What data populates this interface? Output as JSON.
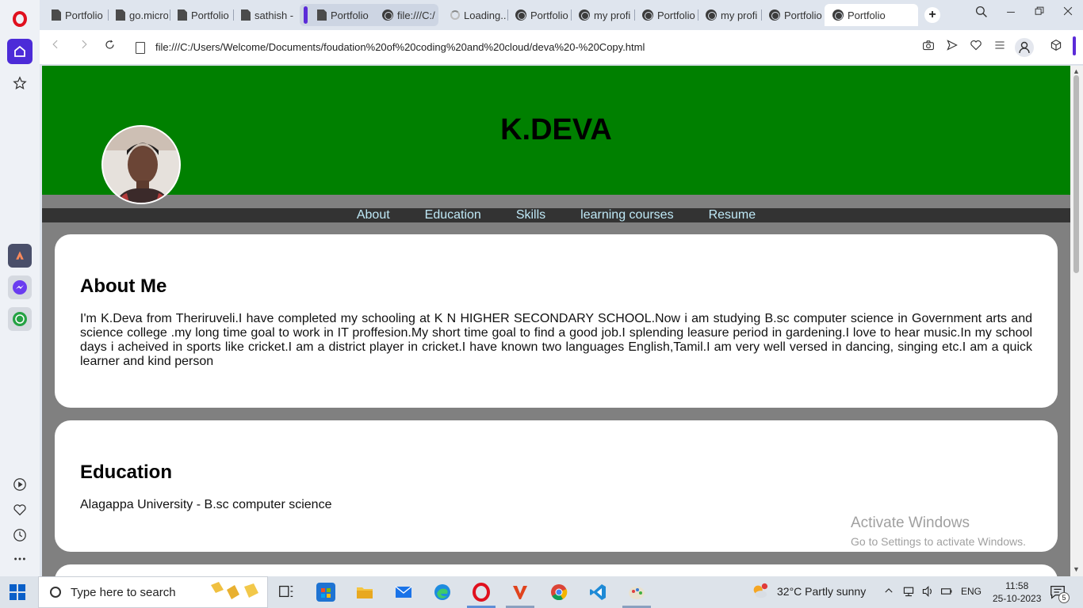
{
  "browser": {
    "tabs": [
      {
        "label": "Portfolio",
        "icon": "page-icon"
      },
      {
        "label": "go.micro",
        "icon": "page-icon"
      },
      {
        "label": "Portfolio",
        "icon": "page-icon"
      },
      {
        "label": "sathish -",
        "icon": "page-icon"
      },
      {
        "label": "Portfolio",
        "icon": "page-icon"
      },
      {
        "label": "file:///C:/",
        "icon": "globe-icon"
      },
      {
        "label": "Loading...",
        "icon": "spinner-icon"
      },
      {
        "label": "Portfolio",
        "icon": "globe-icon"
      },
      {
        "label": "my profi",
        "icon": "globe-icon"
      },
      {
        "label": "Portfolio",
        "icon": "globe-icon"
      },
      {
        "label": "my profi",
        "icon": "globe-icon"
      },
      {
        "label": "Portfolio",
        "icon": "globe-icon"
      },
      {
        "label": "Portfolio",
        "icon": "globe-icon"
      }
    ],
    "url": "file:///C:/Users/Welcome/Documents/foudation%20of%20coding%20and%20cloud/deva%20-%20Copy.html"
  },
  "page": {
    "title": "K.DEVA",
    "nav": [
      "About",
      "Education",
      "Skills",
      "learning courses",
      "Resume"
    ],
    "about": {
      "heading": "About Me",
      "text": "I'm K.Deva from Theriruveli.I have completed my schooling at K N HIGHER SECONDARY SCHOOL.Now i am studying B.sc computer science in Government arts and science college .my long time goal to work in IT proffesion.My short time goal to find a good job.I splending leasure period in gardening.I love to hear music.In my school days i acheived in sports like cricket.I am a district player in cricket.I have known two languages English,Tamil.I am very well versed in dancing, singing etc.I am a quick learner and kind person"
    },
    "education": {
      "heading": "Education",
      "text": "Alagappa University - B.sc computer science"
    },
    "colors": {
      "header": "#008000",
      "nav": "#333333",
      "nav_text": "#bfe9f7",
      "background": "#808080"
    }
  },
  "watermark": {
    "line1": "Activate Windows",
    "line2": "Go to Settings to activate Windows."
  },
  "taskbar": {
    "search_placeholder": "Type here to search",
    "weather": "32°C  Partly sunny",
    "lang": "ENG",
    "time": "11:58",
    "date": "25-10-2023",
    "notifications": "5"
  }
}
